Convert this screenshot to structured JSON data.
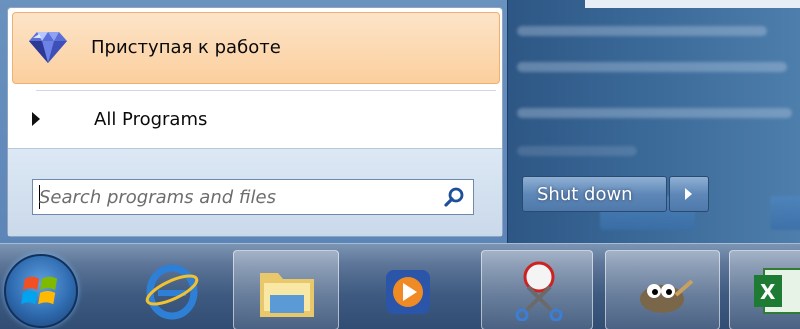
{
  "start_menu": {
    "pinned_item_label": "Приступая к работе",
    "all_programs_label": "All Programs",
    "search": {
      "placeholder": "Search programs and files",
      "value": ""
    },
    "shutdown_label": "Shut down"
  },
  "taskbar": {
    "items": [
      {
        "name": "start-orb",
        "icon": "windows-logo-icon"
      },
      {
        "name": "internet-explorer",
        "icon": "internet-explorer-icon"
      },
      {
        "name": "windows-explorer",
        "icon": "folder-icon"
      },
      {
        "name": "media-player",
        "icon": "media-player-icon"
      },
      {
        "name": "snipping-tool",
        "icon": "scissors-icon"
      },
      {
        "name": "gimp",
        "icon": "gimp-icon"
      },
      {
        "name": "excel",
        "icon": "excel-icon"
      }
    ]
  },
  "colors": {
    "highlight": "#fbcf9e",
    "taskbar": "#3e5a80",
    "search_area": "#dce8f4"
  }
}
